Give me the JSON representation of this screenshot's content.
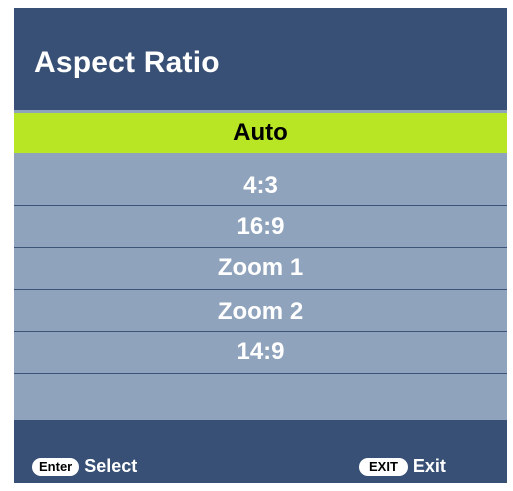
{
  "menu": {
    "title": "Aspect Ratio",
    "items": [
      {
        "label": "Auto",
        "selected": true
      },
      {
        "label": "4:3",
        "selected": false
      },
      {
        "label": "16:9",
        "selected": false
      },
      {
        "label": "Zoom 1",
        "selected": false
      },
      {
        "label": "Zoom 2",
        "selected": false
      },
      {
        "label": "14:9",
        "selected": false
      }
    ]
  },
  "footer": {
    "enter_key": "Enter",
    "enter_label": "Select",
    "exit_key": "EXIT",
    "exit_label": "Exit"
  },
  "colors": {
    "header_bg": "#385075",
    "body_bg": "#8fa3bc",
    "selected_bg": "#b8e524",
    "divider": "#3c5478"
  }
}
